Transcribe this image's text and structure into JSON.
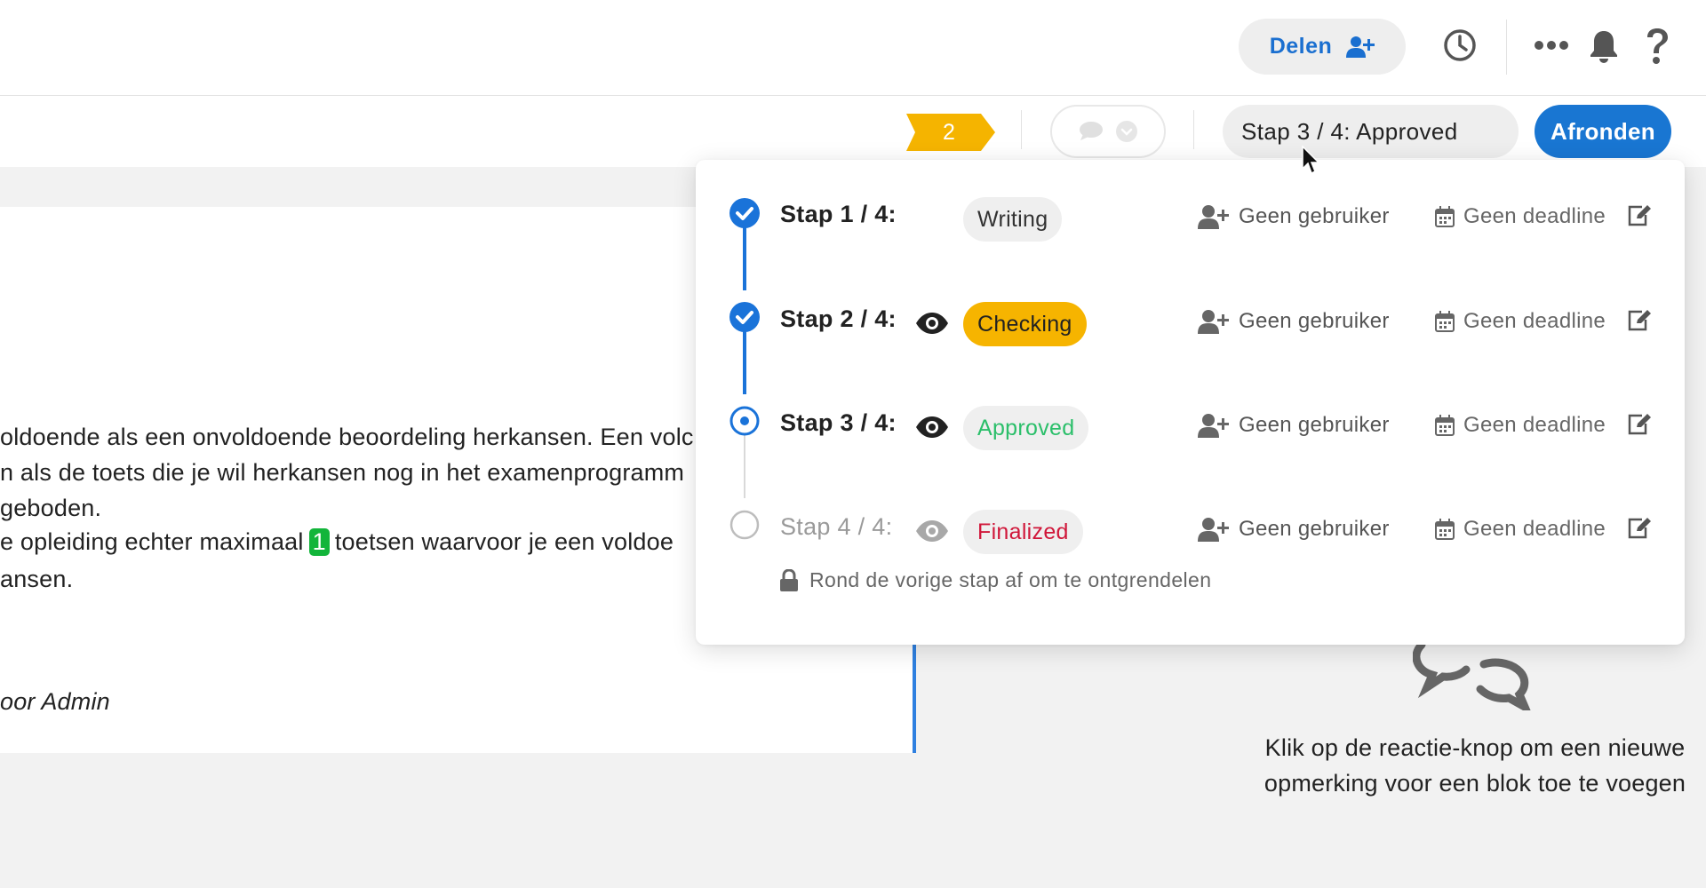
{
  "header": {
    "share_label": "Delen"
  },
  "toolbar": {
    "flag_count": "2",
    "step_select": "Stap 3 / 4: Approved",
    "finish_label": "Afronden"
  },
  "document": {
    "lines": [
      "oldoende als een onvoldoende beoordeling herkansen. Een volc",
      "n als de toets die je wil herkansen nog in het examenprogramm",
      "geboden."
    ],
    "line4_before": "e opleiding echter maximaal",
    "line4_highlight": "1",
    "line4_after": "toetsen waarvoor je een voldoe",
    "line5": "ansen.",
    "author": "oor Admin"
  },
  "comments_panel": {
    "hint": "Klik op de reactie-knop om een nieuwe opmerking voor een blok toe te voegen"
  },
  "workflow": {
    "steps": [
      {
        "label": "Stap 1 / 4:",
        "status": "Writing",
        "user": "Geen gebruiker",
        "deadline": "Geen deadline",
        "state": "done"
      },
      {
        "label": "Stap 2 / 4:",
        "status": "Checking",
        "user": "Geen gebruiker",
        "deadline": "Geen deadline",
        "state": "done"
      },
      {
        "label": "Stap 3 / 4:",
        "status": "Approved",
        "user": "Geen gebruiker",
        "deadline": "Geen deadline",
        "state": "current"
      },
      {
        "label": "Stap 4 / 4:",
        "status": "Finalized",
        "user": "Geen gebruiker",
        "deadline": "Geen deadline",
        "state": "locked"
      }
    ],
    "locked_note": "Rond de vorige stap af om te ontgrendelen"
  },
  "colors": {
    "accent": "#1976d2",
    "checking": "#f6b400",
    "approved": "#2bbf6a",
    "finalized": "#d0173a",
    "highlight": "#12b53a",
    "flag": "#f5b400"
  },
  "icons": [
    "add-user-icon",
    "history-icon",
    "more-icon",
    "bell-icon",
    "help-icon",
    "comment-icon",
    "chevron-down-icon",
    "check-icon",
    "eye-icon",
    "calendar-icon",
    "edit-icon",
    "lock-icon",
    "comments-large-icon",
    "cursor-icon"
  ]
}
